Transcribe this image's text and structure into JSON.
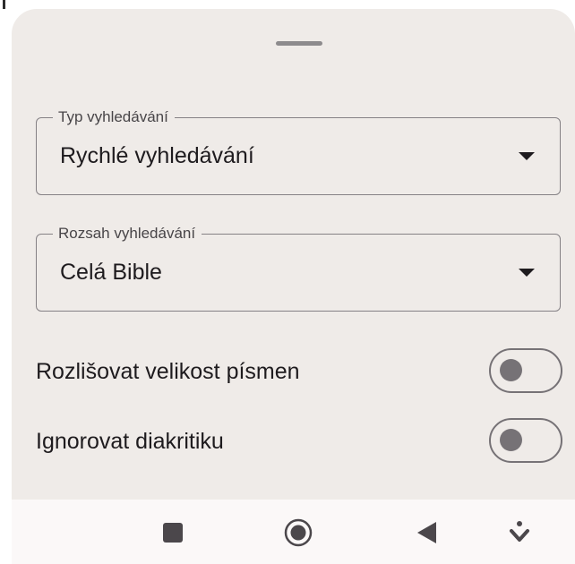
{
  "sheet": {
    "search_type": {
      "label": "Typ vyhledávání",
      "value": "Rychlé vyhledávání"
    },
    "search_range": {
      "label": "Rozsah vyhledávání",
      "value": "Celá Bible"
    },
    "toggles": [
      {
        "label": "Rozlišovat velikost písmen",
        "on": false
      },
      {
        "label": "Ignorovat diakritiku",
        "on": false
      }
    ]
  },
  "navigation_bar": {
    "buttons": [
      "recents-icon",
      "home-icon",
      "back-icon",
      "keyboard-switcher-icon"
    ]
  },
  "colors": {
    "sheet_background": "#efebe8",
    "text": "#1e1b1e",
    "outline": "#858185",
    "switch_off": "#767276",
    "navbar_background": "#fbf8f8"
  }
}
